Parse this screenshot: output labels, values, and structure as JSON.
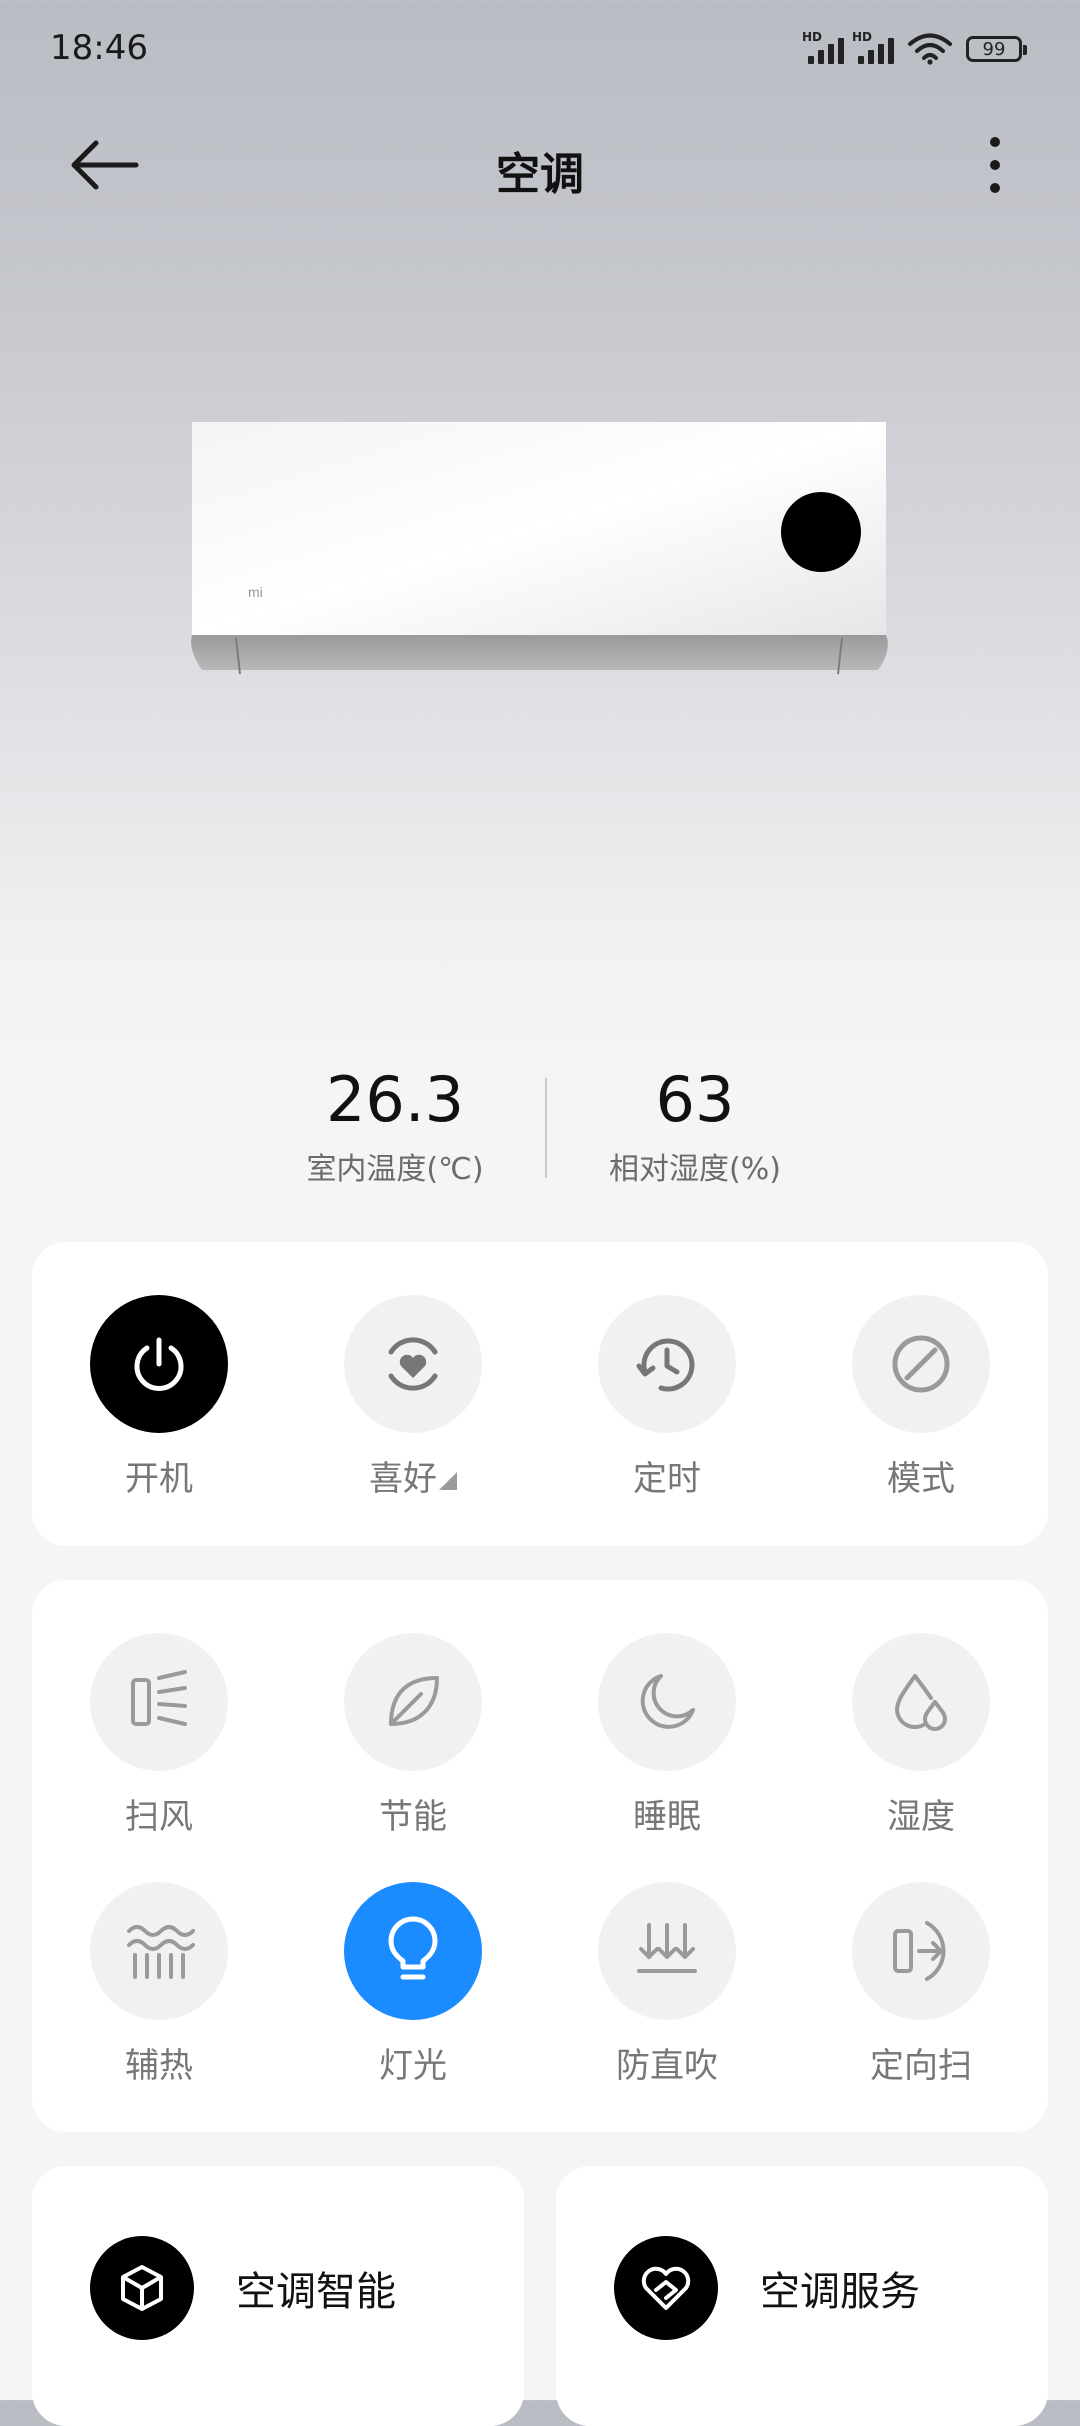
{
  "status_bar": {
    "time": "18:46",
    "network_label_1": "HD",
    "network_label_2": "HD",
    "battery": "99"
  },
  "header": {
    "title": "空调"
  },
  "stats": {
    "indoor_temp": {
      "value": "26.3",
      "label": "室内温度(℃)"
    },
    "humidity": {
      "value": "63",
      "label": "相对湿度(%)"
    }
  },
  "primary_controls": [
    {
      "label": "开机",
      "icon": "power-icon",
      "active": true
    },
    {
      "label": "喜好",
      "icon": "favorite-icon",
      "active": false
    },
    {
      "label": "定时",
      "icon": "timer-icon",
      "active": false
    },
    {
      "label": "模式",
      "icon": "mode-icon",
      "active": false
    }
  ],
  "function_controls": [
    {
      "label": "扫风",
      "icon": "swing-icon",
      "active": false
    },
    {
      "label": "节能",
      "icon": "leaf-icon",
      "active": false
    },
    {
      "label": "睡眠",
      "icon": "moon-icon",
      "active": false
    },
    {
      "label": "湿度",
      "icon": "humidity-icon",
      "active": false
    },
    {
      "label": "辅热",
      "icon": "heat-icon",
      "active": false
    },
    {
      "label": "灯光",
      "icon": "bulb-icon",
      "active": true
    },
    {
      "label": "防直吹",
      "icon": "anti-direct-icon",
      "active": false
    },
    {
      "label": "定向扫",
      "icon": "directional-swing-icon",
      "active": false
    }
  ],
  "features": [
    {
      "label": "空调智能",
      "icon": "cube-icon"
    },
    {
      "label": "空调服务",
      "icon": "heart-service-icon"
    }
  ],
  "colors": {
    "accent": "#1a8cff",
    "active_dark": "#000000",
    "card": "#ffffff"
  }
}
